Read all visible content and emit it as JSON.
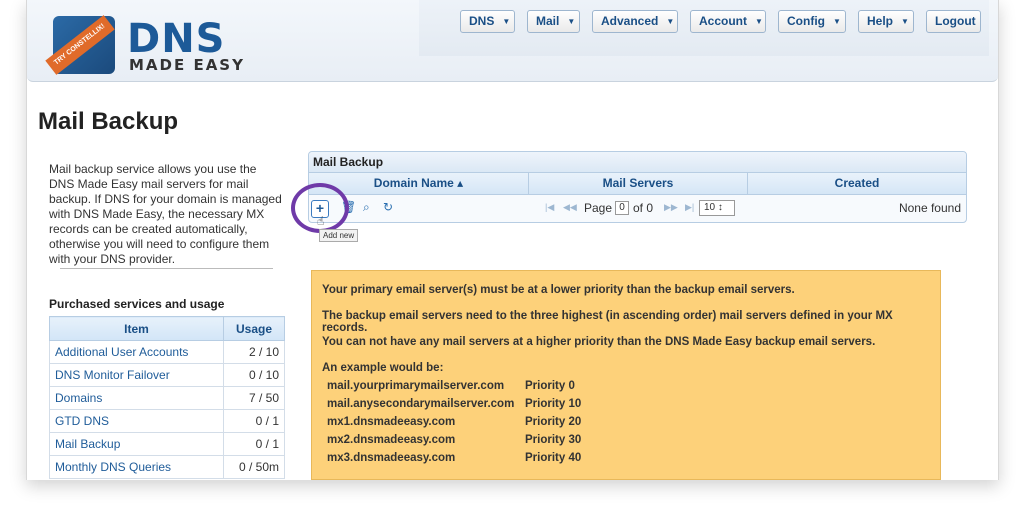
{
  "brand": {
    "badge_text": "TRY CONSTELLIX!",
    "logo_text": "DNS",
    "logo_subtext": "MADE EASY"
  },
  "nav": [
    "DNS",
    "Mail",
    "Advanced",
    "Account",
    "Config",
    "Help",
    "Logout"
  ],
  "page_title": "Mail Backup",
  "intro_text": "Mail backup service allows you use the DNS Made Easy mail servers for mail backup. If DNS for your domain is managed with DNS Made Easy, the necessary MX records can be created automatically, otherwise you will need to configure them with your DNS provider.",
  "purchased": {
    "title": "Purchased services and usage",
    "col_item": "Item",
    "col_usage": "Usage",
    "rows": [
      {
        "item": "Additional User Accounts",
        "usage": "2 / 10"
      },
      {
        "item": "DNS Monitor Failover",
        "usage": "0 / 10"
      },
      {
        "item": "Domains",
        "usage": "7 / 50"
      },
      {
        "item": "GTD DNS",
        "usage": "0 / 1"
      },
      {
        "item": "Mail Backup",
        "usage": "0 / 1"
      },
      {
        "item": "Monthly DNS Queries",
        "usage": "0 / 50m"
      }
    ]
  },
  "grid": {
    "caption": "Mail Backup",
    "columns": [
      "Domain Name ▴",
      "Mail Servers",
      "Created"
    ],
    "page_label": "Page",
    "page_value": "0",
    "of_label": "of 0",
    "page_size": "10 ↕",
    "none_found": "None found",
    "add_tooltip": "Add new",
    "icons": {
      "add": "+",
      "delete": "🗑",
      "search": "⌕",
      "refresh": "↻"
    }
  },
  "note": {
    "line1": "Your primary email server(s) must be at a lower priority than the backup email servers.",
    "line2": "The backup email servers need to the three highest (in ascending order) mail servers defined in your MX records.",
    "line3": "You can not have any mail servers at a higher priority than the DNS Made Easy backup email servers.",
    "example_title": "An example would be:",
    "examples": [
      {
        "server": "mail.yourprimarymailserver.com",
        "priority": "Priority 0"
      },
      {
        "server": "mail.anysecondarymailserver.com",
        "priority": "Priority 10"
      },
      {
        "server": "mx1.dnsmadeeasy.com",
        "priority": "Priority 20"
      },
      {
        "server": "mx2.dnsmadeeasy.com",
        "priority": "Priority 30"
      },
      {
        "server": "mx3.dnsmadeeasy.com",
        "priority": "Priority 40"
      }
    ]
  }
}
